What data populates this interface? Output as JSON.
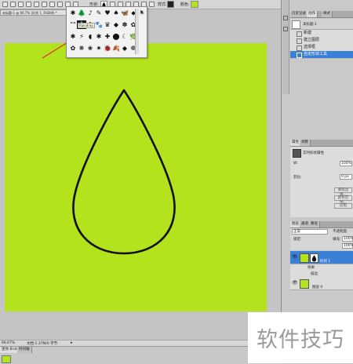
{
  "options_bar": {
    "shape_label": "形状:",
    "style_label": "样式:",
    "color_label": "颜色:",
    "fill_color": "#b3e31c"
  },
  "document": {
    "tab_title": "未标题-1 @ 66.7% (形状 1, RGB/8) *",
    "background_color": "#b3e31c",
    "shape_name": "raindrop",
    "stroke_color": "#111111"
  },
  "shape_picker": {
    "grid": [
      [
        "✱",
        "🌲",
        "♪",
        "✎",
        "♥",
        "♠",
        "🦋",
        "⬥",
        "☀"
      ],
      [
        "\"\"",
        "💧",
        "♣",
        "🐾",
        "♛",
        "◆",
        "✽",
        "✿"
      ],
      [
        "✱",
        "⚡",
        "◖",
        "✱",
        "✚",
        "⬤",
        "☾",
        "🌿"
      ],
      [
        "✿",
        "❋",
        "❀",
        "✷",
        "🐞",
        "🍂",
        "◆",
        "❁"
      ]
    ],
    "tooltip": "Raindrop"
  },
  "status_bar": {
    "zoom": "66.67%",
    "doc_info": "文档:1.37M/0 字节"
  },
  "bottom_tabs": [
    "迷你 Bridge",
    "时间轴"
  ],
  "history_panel": {
    "tabs": [
      "历史记录",
      "动作",
      "样式"
    ],
    "snapshot": "未标题-1",
    "items": [
      "新建",
      "建立图层",
      "选择框",
      "自定形状工具"
    ],
    "selected_index": 3
  },
  "properties_panel": {
    "tabs": [
      "属性",
      "调整"
    ],
    "kind_label": "实时形状属性",
    "rows": [
      {
        "label": "W:",
        "value": "100%"
      },
      {
        "label": "羽化:",
        "value": "0 px"
      }
    ],
    "buttons": [
      "蒙版边缘...",
      "颜色范围...",
      "反相"
    ]
  },
  "layers_panel": {
    "tabs": [
      "图层",
      "通道",
      "路径"
    ],
    "blend_mode": "正常",
    "opacity_label": "不透明度:",
    "opacity": "100%",
    "lock_label": "锁定:",
    "fill_label": "填充:",
    "fill": "100%",
    "layers": [
      {
        "name": "形状 1",
        "selected": true
      },
      {
        "name": "效果",
        "selected": false
      },
      {
        "name": "描边",
        "selected": false
      },
      {
        "name": "图层 0",
        "selected": false
      }
    ]
  },
  "watermark": "软件技巧"
}
